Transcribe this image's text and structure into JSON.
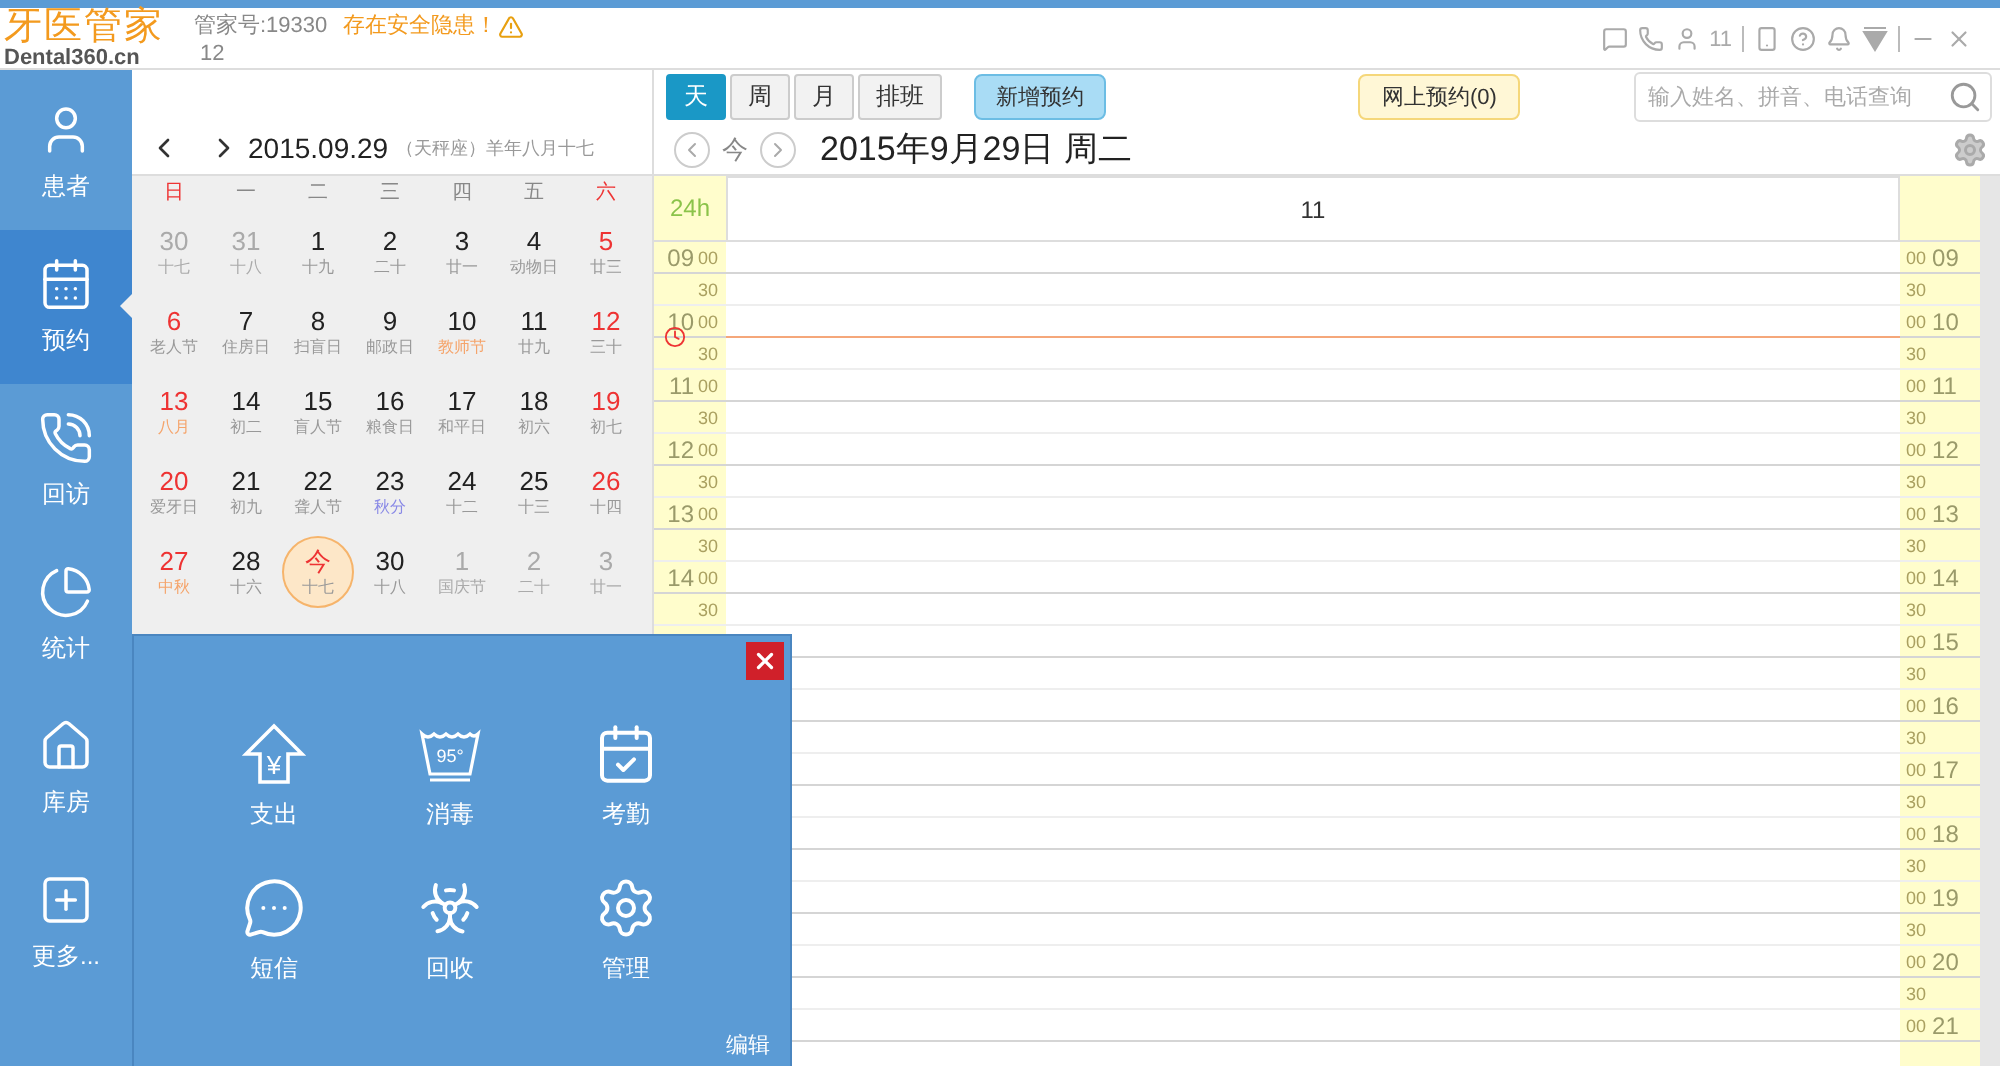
{
  "header": {
    "logo": "牙医管家",
    "logo_sub": "Dental360.cn",
    "account": "管家号:19330",
    "warning": "存在安全隐患！",
    "account_line2": "12",
    "online_count": "11"
  },
  "sidebar": {
    "items": [
      {
        "label": "患者",
        "selected": false
      },
      {
        "label": "预约",
        "selected": true
      },
      {
        "label": "回访",
        "selected": false
      },
      {
        "label": "统计",
        "selected": false
      },
      {
        "label": "库房",
        "selected": false
      },
      {
        "label": "更多...",
        "selected": false
      }
    ]
  },
  "calendar": {
    "date": "2015.09.29",
    "lunar": "（天秤座）羊年八月十七",
    "weekdays": [
      "日",
      "一",
      "二",
      "三",
      "四",
      "五",
      "六"
    ],
    "weeks": [
      [
        {
          "day": "30",
          "sub": "十七",
          "muted": true,
          "today": false,
          "festival": false,
          "solar_term": false
        },
        {
          "day": "31",
          "sub": "十八",
          "muted": true,
          "today": false,
          "festival": false,
          "solar_term": false
        },
        {
          "day": "1",
          "sub": "十九",
          "muted": false,
          "today": false,
          "festival": false,
          "solar_term": false
        },
        {
          "day": "2",
          "sub": "二十",
          "muted": false,
          "today": false,
          "festival": false,
          "solar_term": false
        },
        {
          "day": "3",
          "sub": "廿一",
          "muted": false,
          "today": false,
          "festival": false,
          "solar_term": false
        },
        {
          "day": "4",
          "sub": "动物日",
          "muted": false,
          "today": false,
          "festival": false,
          "solar_term": false
        },
        {
          "day": "5",
          "sub": "廿三",
          "muted": false,
          "today": false,
          "festival": false,
          "solar_term": false
        }
      ],
      [
        {
          "day": "6",
          "sub": "老人节",
          "muted": false,
          "today": false,
          "festival": false,
          "solar_term": false
        },
        {
          "day": "7",
          "sub": "住房日",
          "muted": false,
          "today": false,
          "festival": false,
          "solar_term": false
        },
        {
          "day": "8",
          "sub": "扫盲日",
          "muted": false,
          "today": false,
          "festival": false,
          "solar_term": false
        },
        {
          "day": "9",
          "sub": "邮政日",
          "muted": false,
          "today": false,
          "festival": false,
          "solar_term": false
        },
        {
          "day": "10",
          "sub": "教师节",
          "muted": false,
          "today": false,
          "festival": true,
          "solar_term": false
        },
        {
          "day": "11",
          "sub": "廿九",
          "muted": false,
          "today": false,
          "festival": false,
          "solar_term": false
        },
        {
          "day": "12",
          "sub": "三十",
          "muted": false,
          "today": false,
          "festival": false,
          "solar_term": false
        }
      ],
      [
        {
          "day": "13",
          "sub": "八月",
          "muted": false,
          "today": false,
          "festival": true,
          "solar_term": false
        },
        {
          "day": "14",
          "sub": "初二",
          "muted": false,
          "today": false,
          "festival": false,
          "solar_term": false
        },
        {
          "day": "15",
          "sub": "盲人节",
          "muted": false,
          "today": false,
          "festival": false,
          "solar_term": false
        },
        {
          "day": "16",
          "sub": "粮食日",
          "muted": false,
          "today": false,
          "festival": false,
          "solar_term": false
        },
        {
          "day": "17",
          "sub": "和平日",
          "muted": false,
          "today": false,
          "festival": false,
          "solar_term": false
        },
        {
          "day": "18",
          "sub": "初六",
          "muted": false,
          "today": false,
          "festival": false,
          "solar_term": false
        },
        {
          "day": "19",
          "sub": "初七",
          "muted": false,
          "today": false,
          "festival": false,
          "solar_term": false
        }
      ],
      [
        {
          "day": "20",
          "sub": "爱牙日",
          "muted": false,
          "today": false,
          "festival": false,
          "solar_term": false
        },
        {
          "day": "21",
          "sub": "初九",
          "muted": false,
          "today": false,
          "festival": false,
          "solar_term": false
        },
        {
          "day": "22",
          "sub": "聋人节",
          "muted": false,
          "today": false,
          "festival": false,
          "solar_term": false
        },
        {
          "day": "23",
          "sub": "秋分",
          "muted": false,
          "today": false,
          "festival": false,
          "solar_term": true
        },
        {
          "day": "24",
          "sub": "十二",
          "muted": false,
          "today": false,
          "festival": false,
          "solar_term": false
        },
        {
          "day": "25",
          "sub": "十三",
          "muted": false,
          "today": false,
          "festival": false,
          "solar_term": false
        },
        {
          "day": "26",
          "sub": "十四",
          "muted": false,
          "today": false,
          "festival": false,
          "solar_term": false
        }
      ],
      [
        {
          "day": "27",
          "sub": "中秋",
          "muted": false,
          "today": false,
          "festival": true,
          "solar_term": false
        },
        {
          "day": "28",
          "sub": "十六",
          "muted": false,
          "today": false,
          "festival": false,
          "solar_term": false
        },
        {
          "day": "今",
          "sub": "十七",
          "muted": false,
          "today": true,
          "festival": false,
          "solar_term": false
        },
        {
          "day": "30",
          "sub": "十八",
          "muted": false,
          "today": false,
          "festival": false,
          "solar_term": false
        },
        {
          "day": "1",
          "sub": "国庆节",
          "muted": true,
          "today": false,
          "festival": false,
          "solar_term": false
        },
        {
          "day": "2",
          "sub": "二十",
          "muted": true,
          "today": false,
          "festival": false,
          "solar_term": false
        },
        {
          "day": "3",
          "sub": "廿一",
          "muted": true,
          "today": false,
          "festival": false,
          "solar_term": false
        }
      ]
    ]
  },
  "toolbar": {
    "view_tabs": [
      {
        "label": "天",
        "selected": true
      },
      {
        "label": "周",
        "selected": false
      },
      {
        "label": "月",
        "selected": false
      },
      {
        "label": "排班",
        "selected": false
      }
    ],
    "new_button": "新增预约",
    "online_button": "网上预约(0)",
    "search": {
      "placeholder": "输入姓名、拼音、电话查询"
    }
  },
  "schedule": {
    "today_button": "今",
    "title": "2015年9月29日 周二",
    "range_label": "24h",
    "columns": [
      "11"
    ],
    "left_slots": [
      {
        "hour": "09",
        "minute": "00",
        "now": false
      },
      {
        "minute": "30",
        "now": false
      },
      {
        "hour": "10",
        "minute": "00",
        "now": true
      },
      {
        "minute": "30",
        "now": false
      },
      {
        "hour": "11",
        "minute": "00",
        "now": false
      },
      {
        "minute": "30",
        "now": false
      },
      {
        "hour": "12",
        "minute": "00",
        "now": false
      },
      {
        "minute": "30",
        "now": false
      },
      {
        "hour": "13",
        "minute": "00",
        "now": false
      },
      {
        "minute": "30",
        "now": false
      },
      {
        "hour": "14",
        "minute": "00",
        "now": false
      },
      {
        "minute": "30",
        "now": false
      }
    ],
    "right_slots": [
      {
        "hour": "09",
        "minute": "00"
      },
      {
        "minute": "30"
      },
      {
        "hour": "10",
        "minute": "00"
      },
      {
        "minute": "30"
      },
      {
        "hour": "11",
        "minute": "00"
      },
      {
        "minute": "30"
      },
      {
        "hour": "12",
        "minute": "00"
      },
      {
        "minute": "30"
      },
      {
        "hour": "13",
        "minute": "00"
      },
      {
        "minute": "30"
      },
      {
        "hour": "14",
        "minute": "00"
      },
      {
        "minute": "30"
      },
      {
        "hour": "15",
        "minute": "00"
      },
      {
        "minute": "30"
      },
      {
        "hour": "16",
        "minute": "00"
      },
      {
        "minute": "30"
      },
      {
        "hour": "17",
        "minute": "00"
      },
      {
        "minute": "30"
      },
      {
        "hour": "18",
        "minute": "00"
      },
      {
        "minute": "30"
      },
      {
        "hour": "19",
        "minute": "00"
      },
      {
        "minute": "30"
      },
      {
        "hour": "20",
        "minute": "00"
      },
      {
        "minute": "30"
      },
      {
        "hour": "21",
        "minute": "00"
      }
    ]
  },
  "popup": {
    "items": [
      {
        "label": "支出",
        "icon_text": "¥"
      },
      {
        "label": "消毒",
        "icon_text": "95°"
      },
      {
        "label": "考勤"
      },
      {
        "label": "短信"
      },
      {
        "label": "回收"
      },
      {
        "label": "管理"
      }
    ],
    "edit": "编辑"
  }
}
